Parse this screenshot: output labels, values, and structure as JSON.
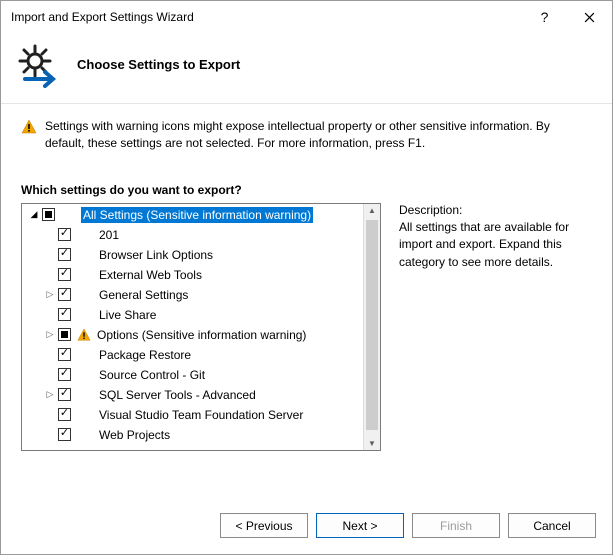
{
  "window": {
    "title": "Import and Export Settings Wizard"
  },
  "header": {
    "title": "Choose Settings to Export"
  },
  "warning": {
    "text": "Settings with warning icons might expose intellectual property or other sensitive information. By default, these settings are not selected. For more information, press F1."
  },
  "question": "Which settings do you want to export?",
  "tree": {
    "items": [
      {
        "label": "All Settings (Sensitive information warning)",
        "indent": 0,
        "expand": "open",
        "check": "indet",
        "selected": true,
        "warn": false
      },
      {
        "label": "201",
        "indent": 1,
        "expand": "none",
        "check": "checked",
        "selected": false,
        "warn": false
      },
      {
        "label": "Browser Link Options",
        "indent": 1,
        "expand": "none",
        "check": "checked",
        "selected": false,
        "warn": false
      },
      {
        "label": "External Web Tools",
        "indent": 1,
        "expand": "none",
        "check": "checked",
        "selected": false,
        "warn": false
      },
      {
        "label": "General Settings",
        "indent": 1,
        "expand": "closed",
        "check": "checked",
        "selected": false,
        "warn": false
      },
      {
        "label": "Live Share",
        "indent": 1,
        "expand": "none",
        "check": "checked",
        "selected": false,
        "warn": false
      },
      {
        "label": "Options (Sensitive information warning)",
        "indent": 1,
        "expand": "closed",
        "check": "indet",
        "selected": false,
        "warn": true
      },
      {
        "label": "Package Restore",
        "indent": 1,
        "expand": "none",
        "check": "checked",
        "selected": false,
        "warn": false
      },
      {
        "label": "Source Control - Git",
        "indent": 1,
        "expand": "none",
        "check": "checked",
        "selected": false,
        "warn": false
      },
      {
        "label": "SQL Server Tools - Advanced",
        "indent": 1,
        "expand": "closed",
        "check": "checked",
        "selected": false,
        "warn": false
      },
      {
        "label": "Visual Studio Team Foundation Server",
        "indent": 1,
        "expand": "none",
        "check": "checked",
        "selected": false,
        "warn": false
      },
      {
        "label": "Web Projects",
        "indent": 1,
        "expand": "none",
        "check": "checked",
        "selected": false,
        "warn": false
      }
    ]
  },
  "desc": {
    "title": "Description:",
    "text": "All settings that are available for import and export. Expand this category to see more details."
  },
  "buttons": {
    "previous": "< Previous",
    "next": "Next >",
    "finish": "Finish",
    "cancel": "Cancel"
  }
}
